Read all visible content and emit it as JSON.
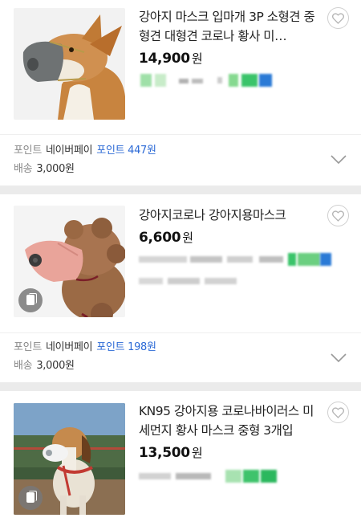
{
  "products": [
    {
      "title": "강아지 마스크 입마개 3P 소형견 중형견 대형견 코로나 황사 미…",
      "price": "14,900",
      "currency": "원",
      "point_label": "포인트",
      "pay_label": "네이버페이",
      "point_text": "포인트 447원",
      "shipping_label": "배송",
      "shipping_value": "3,000원"
    },
    {
      "title": "강아지코로나 강아지용마스크",
      "price": "6,600",
      "currency": "원",
      "point_label": "포인트",
      "pay_label": "네이버페이",
      "point_text": "포인트 198원",
      "shipping_label": "배송",
      "shipping_value": "3,000원"
    },
    {
      "title": "KN95 강아지용 코로나바이러스 미세먼지 황사 마스크 중형 3개입",
      "price": "13,500",
      "currency": "원"
    }
  ],
  "icons": {
    "wishlist": "heart-icon",
    "expand": "chevron-down-icon",
    "gallery": "gallery-icon"
  },
  "colors": {
    "accent_blue": "#2c6ad6",
    "background": "#ebebeb",
    "blur_green": "#2fbf5a",
    "blur_blue": "#2a7ad6"
  }
}
